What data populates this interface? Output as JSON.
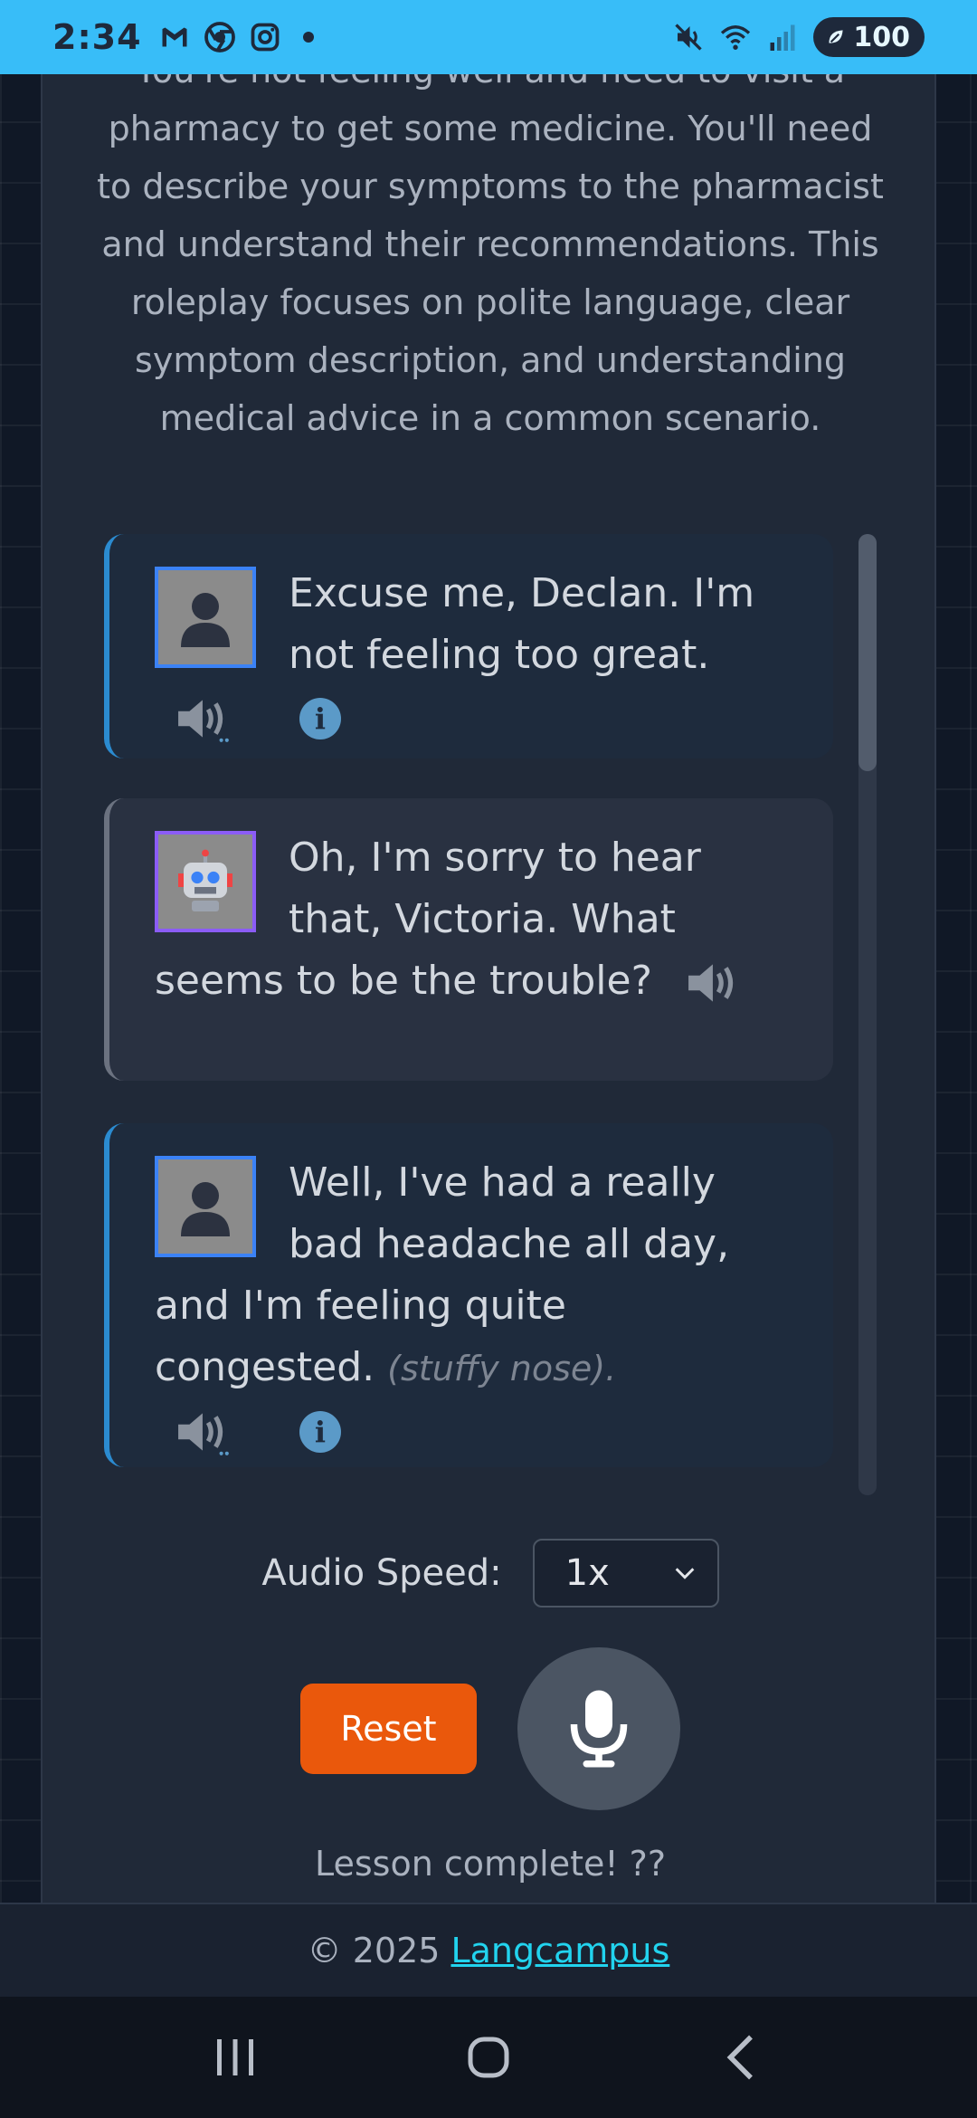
{
  "status_bar": {
    "time": "2:34",
    "battery": "100",
    "icons": [
      "gmail-icon",
      "chrome-icon",
      "instagram-icon",
      "dot-icon",
      "mute-icon",
      "wifi-icon",
      "signal-icon"
    ]
  },
  "lesson": {
    "description": "You're not feeling well and need to visit a pharmacy to get some medicine. You'll need to describe your symptoms to the pharmacist and understand their recommendations. This roleplay focuses on polite language, clear symptom description, and understanding medical advice in a common scenario."
  },
  "messages": [
    {
      "speaker": "user",
      "text": "Excuse me, Declan. I'm not feeling too great.",
      "gloss": ""
    },
    {
      "speaker": "bot",
      "text": "Oh, I'm sorry to hear that, Victoria. What seems to be the trouble?",
      "gloss": ""
    },
    {
      "speaker": "user",
      "text": "Well, I've had a really bad headache all day, and I'm feeling quite congested.",
      "gloss": "(stuffy nose)."
    }
  ],
  "controls": {
    "audio_speed_label": "Audio Speed:",
    "audio_speed_value": "1x",
    "reset_label": "Reset",
    "lesson_status": "Lesson complete! ??"
  },
  "footer": {
    "copyright": "© 2025",
    "link_text": "Langcampus"
  },
  "colors": {
    "status_bar": "#38bdf8",
    "reset_button": "#ea580c",
    "user_accent": "#2b8bd0",
    "bot_accent": "#6b7280",
    "link": "#22d3ee"
  }
}
